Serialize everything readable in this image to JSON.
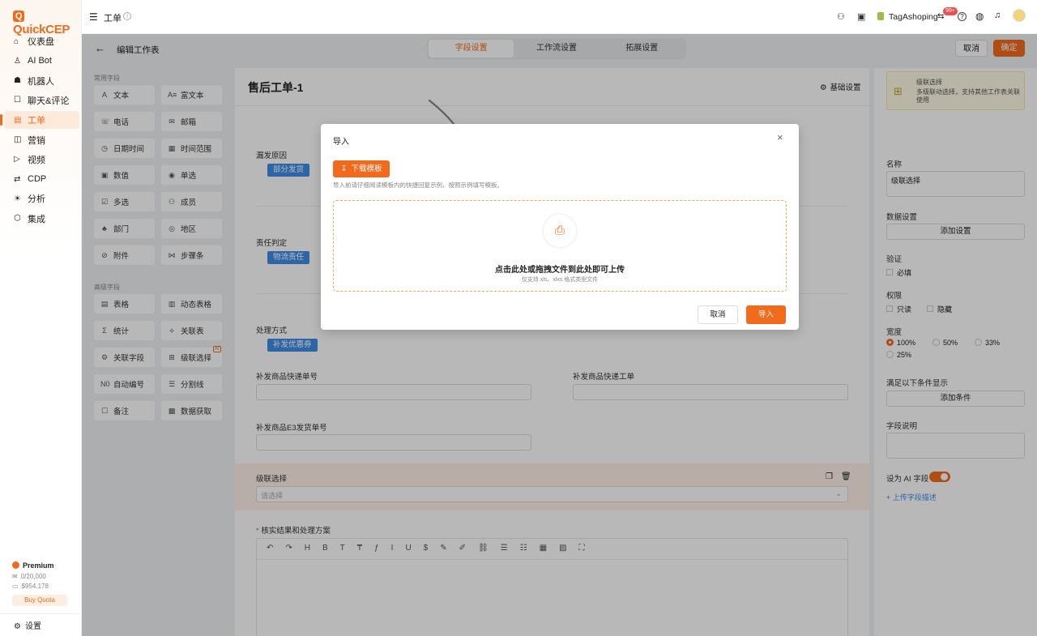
{
  "app": {
    "logo": "QuickCEP"
  },
  "nav": {
    "items": [
      {
        "label": "仪表盘",
        "icon": "dashboard-icon"
      },
      {
        "label": "AI Bot",
        "icon": "ai-bot-icon"
      },
      {
        "label": "机器人",
        "icon": "robot-icon"
      },
      {
        "label": "聊天&评论",
        "icon": "chat-icon"
      },
      {
        "label": "工单",
        "icon": "ticket-icon",
        "active": true
      },
      {
        "label": "营销",
        "icon": "marketing-icon"
      },
      {
        "label": "视频",
        "icon": "video-icon"
      },
      {
        "label": "CDP",
        "icon": "cdp-icon"
      },
      {
        "label": "分析",
        "icon": "analytics-icon"
      },
      {
        "label": "集成",
        "icon": "integration-icon"
      }
    ],
    "premium": {
      "title": "Premium",
      "usage": "0/20,000",
      "balance": "$954.178",
      "buy": "Buy Quota"
    },
    "settings": "设置"
  },
  "topbar": {
    "title": "工单",
    "badge": "99+",
    "store": "TagAshoping"
  },
  "subbar": {
    "title": "编辑工作表",
    "tabs": [
      "字段设置",
      "工作流设置",
      "拓展设置"
    ],
    "cancel": "取消",
    "confirm": "确定"
  },
  "palette": {
    "common_title": "常用字段",
    "common": [
      [
        "文本",
        "A"
      ],
      [
        "富文本",
        "A≡"
      ],
      [
        "电话",
        "☏"
      ],
      [
        "邮箱",
        "✉"
      ],
      [
        "日期时间",
        "◷"
      ],
      [
        "时间范围",
        "▦"
      ],
      [
        "数值",
        "▣"
      ],
      [
        "单选",
        "◉"
      ],
      [
        "多选",
        "☑"
      ],
      [
        "成员",
        "⚇"
      ],
      [
        "部门",
        "♣"
      ],
      [
        "地区",
        "◎"
      ],
      [
        "附件",
        "⊘"
      ],
      [
        "步骤条",
        "⋈"
      ]
    ],
    "advanced_title": "高级字段",
    "advanced": [
      [
        "表格",
        "▤"
      ],
      [
        "动态表格",
        "▥"
      ],
      [
        "统计",
        "Σ"
      ],
      [
        "关联表",
        "⟡"
      ],
      [
        "关联字段",
        "⚙"
      ],
      [
        "级联选择",
        "⊞"
      ],
      [
        "自动编号",
        "N0"
      ],
      [
        "分割线",
        "☰"
      ],
      [
        "备注",
        "☐"
      ],
      [
        "数据获取",
        "▩"
      ]
    ],
    "ai_badge": "AI"
  },
  "form": {
    "title": "售后工单-1",
    "base_settings": "基础设置",
    "missing_reason": "漏发原因",
    "missing_chip": "部分发货",
    "responsibility": "责任判定",
    "resp_chip": "物流责任",
    "handling": "处理方式",
    "handling_chip": "补发优惠券",
    "reship_tracking": "补发商品快递单号",
    "reship_ticket": "补发商品快递工单",
    "reship_e3": "补发商品E3发货单号",
    "cascade": "级联选择",
    "cascade_placeholder": "请选择",
    "verify": "核实结果和处理方案",
    "required_mark": "*"
  },
  "rightpanel": {
    "card_title": "级联选择",
    "card_desc": "多级联动选择，支持其他工作表关联使用",
    "name_label": "名称",
    "name_value": "级联选择",
    "data_label": "数据设置",
    "data_btn": "添加设置",
    "validate_label": "验证",
    "required": "必填",
    "perm_label": "权限",
    "readonly": "只读",
    "hidden": "隐藏",
    "width_label": "宽度",
    "widths": [
      "100%",
      "50%",
      "33%",
      "25%"
    ],
    "cond_label": "满足以下条件显示",
    "cond_btn": "添加条件",
    "desc_label": "字段说明",
    "ai_label": "设为 AI 字段",
    "upload_link": "+ 上传字段描述"
  },
  "modal": {
    "title": "导入",
    "download": "下载模板",
    "hint": "导入前请仔细阅读模板内的快捷回复示例，按照示例填写模板。",
    "drop_main": "点击此处或拖拽文件到此处即可上传",
    "drop_sub": "仅支持 xls、xlxs 格式类型文件",
    "cancel": "取消",
    "import": "导入"
  },
  "colors": {
    "accent": "#f26b1d",
    "chip": "#3f8ee8"
  }
}
